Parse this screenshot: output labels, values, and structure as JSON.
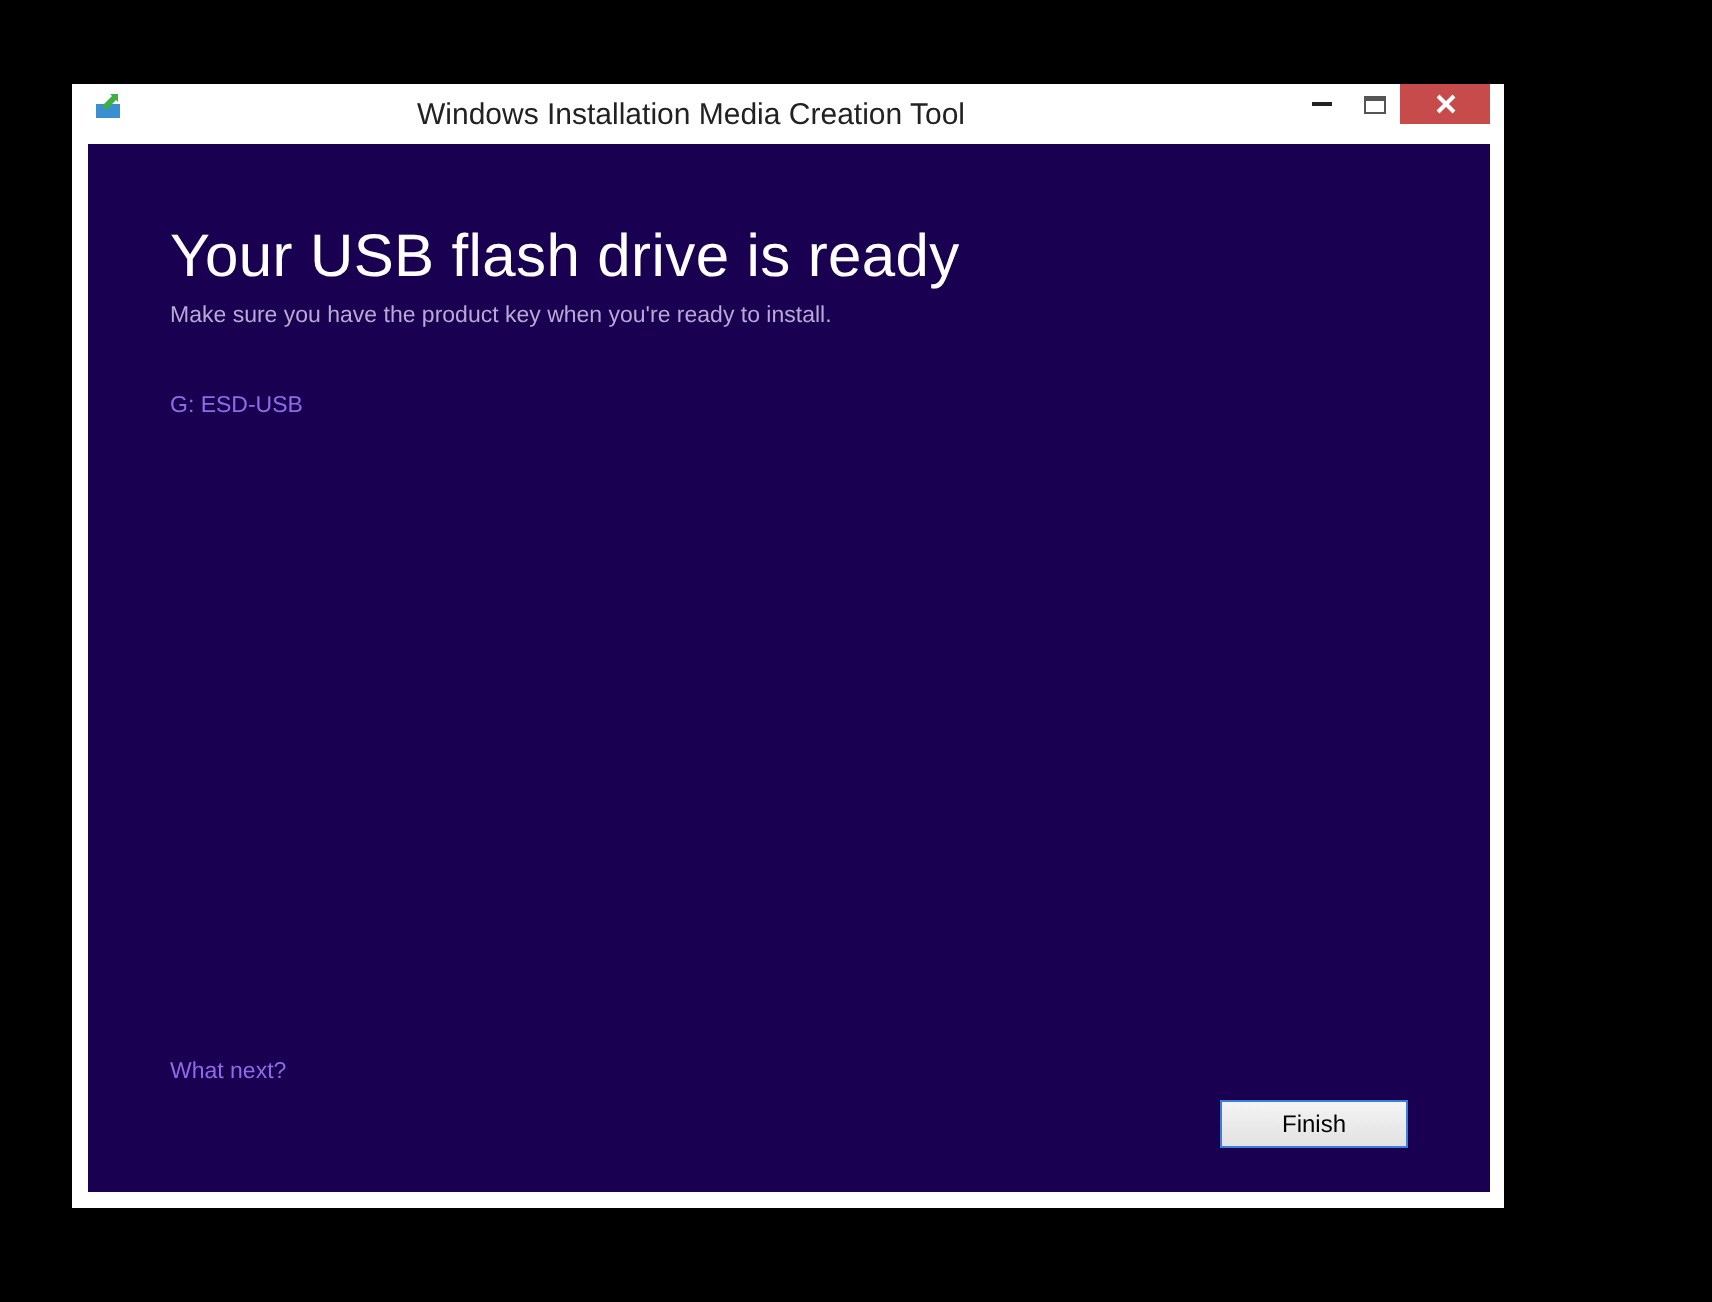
{
  "window": {
    "title": "Windows Installation Media Creation Tool"
  },
  "heading": "Your USB flash drive is ready",
  "subtitle": "Make sure you have the product key when you're ready to install.",
  "drive_link": "G: ESD-USB",
  "what_next_link": "What next?",
  "buttons": [
    "Finish"
  ]
}
